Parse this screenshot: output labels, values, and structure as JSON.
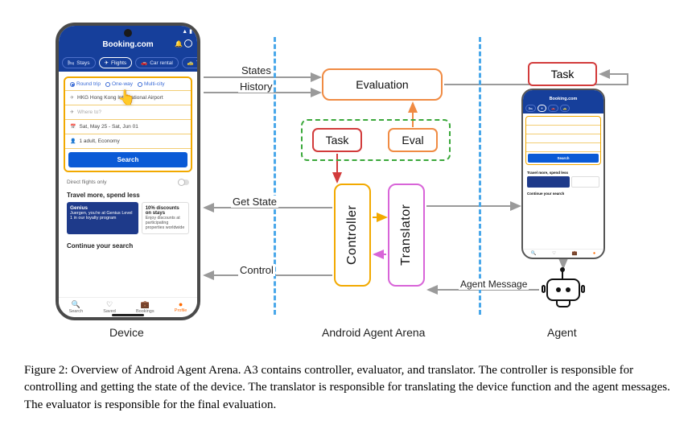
{
  "figure_number": "Figure 2",
  "caption": "Figure 2: Overview of Android Agent Arena. A3 contains controller, evaluator, and translator. The controller is responsible for controlling and getting the state of the device. The translator is responsible for translating the device function and the agent messages. The evaluator is responsible for the final evaluation.",
  "columns": {
    "device_label": "Device",
    "arena_label": "Android Agent Arena",
    "agent_label": "Agent"
  },
  "modules": {
    "evaluation": "Evaluation",
    "task_badge": "Task",
    "eval_badge": "Eval",
    "controller": "Controller",
    "translator": "Translator",
    "task_top": "Task"
  },
  "flows": {
    "states": "States",
    "history": "History",
    "get_state": "Get State",
    "control": "Control",
    "agent_message": "Agent Message"
  },
  "device_screen": {
    "app_title": "Booking.com",
    "tabs": [
      "Stays",
      "Flights",
      "Car rental",
      "Ta"
    ],
    "active_tab_index": 1,
    "trip_options": [
      "Round trip",
      "One-way",
      "Multi-city"
    ],
    "selected_trip_index": 0,
    "from_value": "HKG Hong Kong International Airport",
    "to_placeholder": "Where to?",
    "dates_value": "Sat, May 25 - Sat, Jun 01",
    "pax_value": "1 adult, Economy",
    "search_button": "Search",
    "direct_flights_label": "Direct flights only",
    "section_travel_more": "Travel more, spend less",
    "genius_card": {
      "title": "Genius",
      "body": "Juergen, you're at Genius Level 1 in our loyalty program"
    },
    "discount_card": {
      "title": "10% discounts on stays",
      "body": "Enjoy discounts at participating properties worldwide"
    },
    "section_continue": "Continue your search",
    "bottom_nav": [
      {
        "label": "Search",
        "active": false
      },
      {
        "label": "Saved",
        "active": false
      },
      {
        "label": "Bookings",
        "active": false
      },
      {
        "label": "Profile",
        "active": true
      }
    ]
  },
  "agent_screen": {
    "app_title": "Booking.com",
    "search_button": "Search",
    "section_travel_more": "Travel more, spend less",
    "section_continue": "Continue your search"
  },
  "colors": {
    "booking_blue": "#163f9b",
    "booking_accent": "#f2a900",
    "eval_orange": "#f08b43",
    "task_red": "#d23b3b",
    "green_dash": "#3aa83a",
    "ctrl_yellow": "#f2a900",
    "trans_pink": "#d864d8",
    "dash_blue": "#4aa8ea",
    "arrow_gray": "#9a9a9a"
  }
}
